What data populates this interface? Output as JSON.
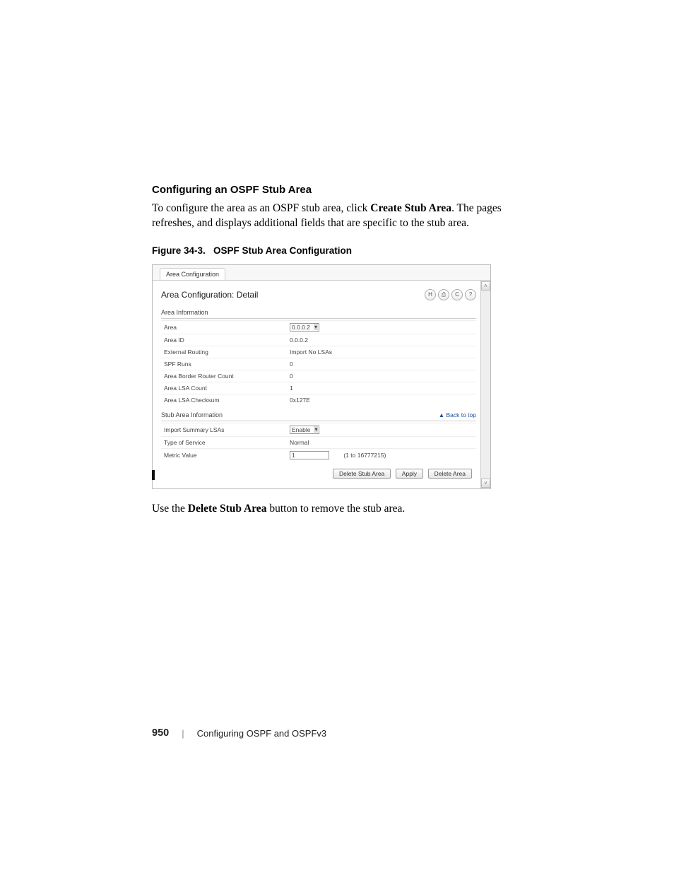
{
  "heading": "Configuring an OSPF Stub Area",
  "body": {
    "p1a": "To configure the area as an OSPF stub area, click ",
    "p1b": "Create Stub Area",
    "p1c": ". The pages refreshes, and displays additional fields that are specific to the stub area."
  },
  "figure": {
    "label": "Figure 34-3.",
    "title": "OSPF Stub Area Configuration"
  },
  "screenshot": {
    "tab": "Area Configuration",
    "panel_title": "Area Configuration: Detail",
    "section1": "Area Information",
    "area_info": {
      "area_label": "Area",
      "area_value": "0.0.0.2",
      "area_id_label": "Area ID",
      "area_id_value": "0.0.0.2",
      "ext_routing_label": "External Routing",
      "ext_routing_value": "Import No LSAs",
      "spf_runs_label": "SPF Runs",
      "spf_runs_value": "0",
      "abr_count_label": "Area Border Router Count",
      "abr_count_value": "0",
      "lsa_count_label": "Area LSA Count",
      "lsa_count_value": "1",
      "lsa_cksum_label": "Area LSA Checksum",
      "lsa_cksum_value": "0x127E"
    },
    "section2": "Stub Area Information",
    "back_to_top": "▲ Back to top",
    "stub_info": {
      "import_label": "Import Summary LSAs",
      "import_value": "Enable",
      "tos_label": "Type of Service",
      "tos_value": "Normal",
      "metric_label": "Metric Value",
      "metric_value": "1",
      "metric_range": "(1 to 16777215)"
    },
    "buttons": {
      "delete_stub": "Delete Stub Area",
      "apply": "Apply",
      "delete_area": "Delete Area"
    }
  },
  "post_text": {
    "a": "Use the ",
    "b": "Delete Stub Area",
    "c": " button to remove the stub area."
  },
  "footer": {
    "page": "950",
    "chapter": "Configuring OSPF and OSPFv3"
  }
}
